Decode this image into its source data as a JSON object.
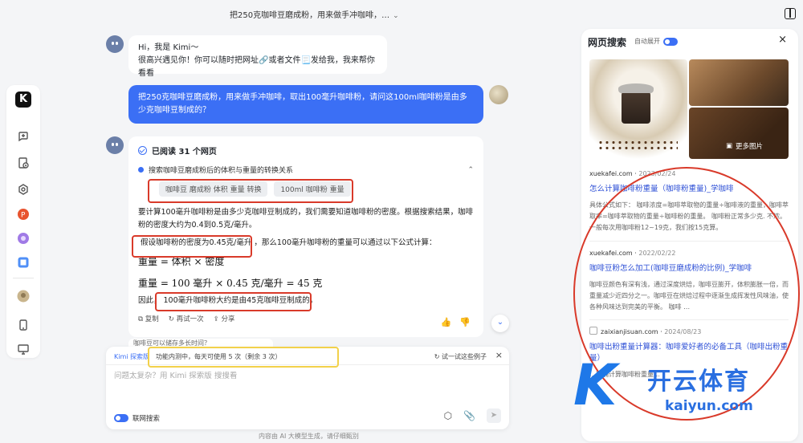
{
  "header": {
    "chat_title": "把250克咖啡豆磨成粉，用来做手冲咖啡，…"
  },
  "sidebar": {
    "logo": "K"
  },
  "greeting": {
    "line1": "Hi，我是 Kimi～",
    "line2": "很高兴遇见你！你可以随时把网址🔗或者文件📃发给我，我来帮你看看"
  },
  "user_message": "把250克咖啡豆磨成粉，用来做手冲咖啡，取出100毫升咖啡粉，请问这100ml咖啡粉是由多少克咖啡豆制成的？",
  "answer": {
    "read_header": "已阅读 31 个网页",
    "search_title": "搜索咖啡豆磨成粉后的体积与重量的转换关系",
    "tags": [
      "咖啡豆 磨成粉 体积 重量 转换",
      "100ml 咖啡粉 重量"
    ],
    "para1": "要计算100毫升咖啡粉是由多少克咖啡豆制成的，我们需要知道咖啡粉的密度。根据搜索结果，咖啡粉的密度大约为0.4到0.5克/毫升。",
    "assume": "假设咖啡粉的密度为0.45克/毫升",
    "para2_rest": "，那么100毫升咖啡粉的重量可以通过以下公式计算：",
    "formula1": "重量 = 体积 × 密度",
    "formula2": "重量 = 100 毫升 × 0.45 克/毫升 = 45 克",
    "conclusion_prefix": "因此，",
    "conclusion": "100毫升咖啡粉大约是由45克咖啡豆制成的。",
    "actions": {
      "copy": "复制",
      "retry": "再试一次",
      "share": "分享"
    }
  },
  "prev_snippet": "咖啡豆可以储存多长时间？",
  "input": {
    "mode_tag": "Kimi 探索版",
    "notice": "功能内测中，每天可使用 5 次（剩余 3 次）",
    "try_example": "试一试这些例子",
    "placeholder": "问题太复杂？用 Kimi 探索版 搜搜看",
    "web_search_label": "联网搜索"
  },
  "footer": "内容由 AI 大模型生成，请仔细甄别",
  "right_panel": {
    "title": "网页搜索",
    "auto_expand": "自动展开",
    "more_images": "更多图片",
    "results": [
      {
        "source": "xuekafei.com",
        "date": "2023/02/24",
        "title": "怎么计算咖啡粉重量（咖啡粉重量)_学咖啡",
        "snippet": "具体公式如下： 咖啡浓度=咖啡萃取物的重量÷咖啡液的重量，咖啡萃取率=咖啡萃取物的重量÷咖啡粉的重量。 咖啡粉正常多少克. 不浓。 一般每次用咖啡粉12~19克，我们按15克算。"
      },
      {
        "source": "xuekafei.com",
        "date": "2022/02/22",
        "title": "咖啡豆粉怎么加工(咖啡豆磨成粉的比例)_学咖啡",
        "snippet": "咖啡豆颜色有深有浅，通过深度烘焙，咖啡豆膨开，体积膨胀一倍，而重量减少近四分之一。咖啡豆在烘焙过程中逐渐生成挥发性风味油，使各种风味达到完美的平衡。 咖啡 …"
      },
      {
        "source": "zaixianjisuan.com",
        "date": "2024/08/23",
        "title": "咖啡出粉重量计算器：咖啡爱好者的必备工具（咖啡出粉重量）",
        "snippet": "…准确计算咖啡粉重量…"
      }
    ]
  },
  "watermark": {
    "brand": "开云体育",
    "domain": "kaiyun.com"
  },
  "colors": {
    "accent": "#3b6ff5",
    "annotation_red": "#d93a2a",
    "annotation_yellow": "#f2d14a"
  }
}
